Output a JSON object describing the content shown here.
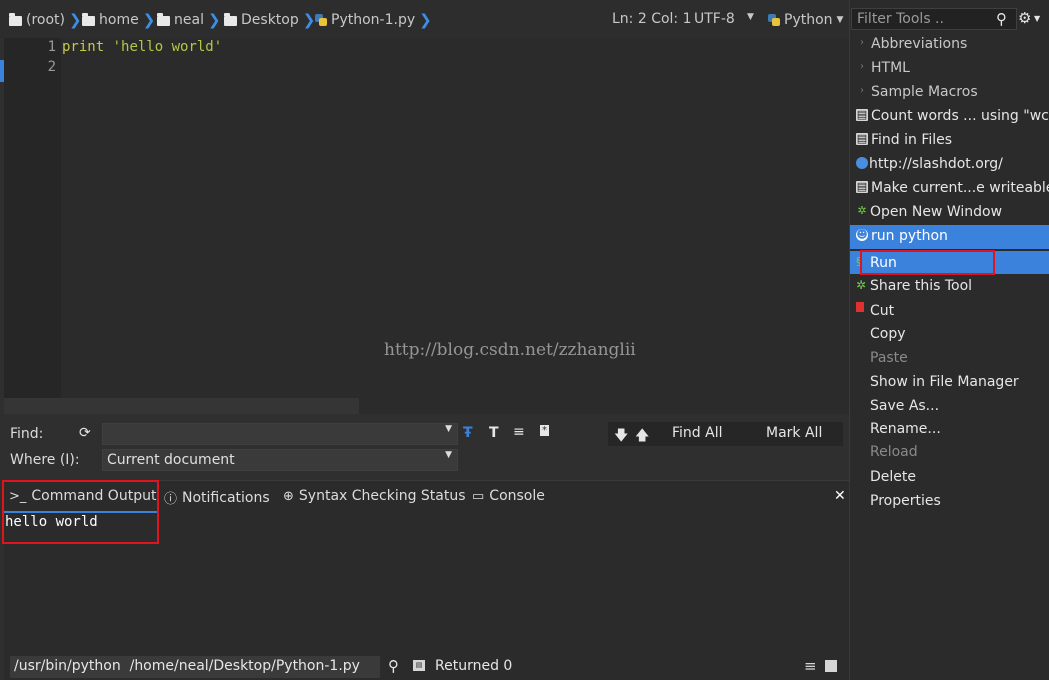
{
  "breadcrumb": {
    "items": [
      "(root)",
      "home",
      "neal",
      "Desktop",
      "Python-1.py"
    ]
  },
  "statusbar": {
    "position": "Ln: 2 Col: 1",
    "encoding": "UTF-8",
    "language": "Python"
  },
  "editor": {
    "line_numbers": [
      "1",
      "2"
    ],
    "code": {
      "keyword": "print",
      "string": "'hello world'"
    }
  },
  "watermark": "http://blog.csdn.net/zzhanglii",
  "find": {
    "find_label": "Find:",
    "where_label": "Where (I):",
    "where_value": "Current document",
    "find_value": "",
    "find_all": "Find All",
    "mark_all": "Mark All"
  },
  "panel": {
    "tabs": [
      "Command Output",
      "Notifications",
      "Syntax Checking Status",
      "Console"
    ],
    "output": "hello world",
    "command": "/usr/bin/python  /home/neal/Desktop/Python-1.py",
    "result": "Returned 0"
  },
  "toolbox": {
    "filter_placeholder": "Filter Tools ..",
    "folders": [
      "Abbreviations",
      "HTML",
      "Sample Macros"
    ],
    "tools": [
      "Count words ... using \"wc\"",
      "Find in Files",
      "http://slashdot.org/",
      "Make current...e writeable",
      "Open New Window",
      "run python"
    ]
  },
  "context_menu": {
    "items": [
      "Run",
      "Share this Tool",
      "Cut",
      "Copy",
      "Paste",
      "Show in File Manager",
      "Save As...",
      "Rename...",
      "Reload",
      "Delete",
      "Properties"
    ]
  },
  "colors": {
    "accent": "#3b82dd",
    "highlight_box": "#e0141c",
    "background": "#2b2b2b"
  }
}
